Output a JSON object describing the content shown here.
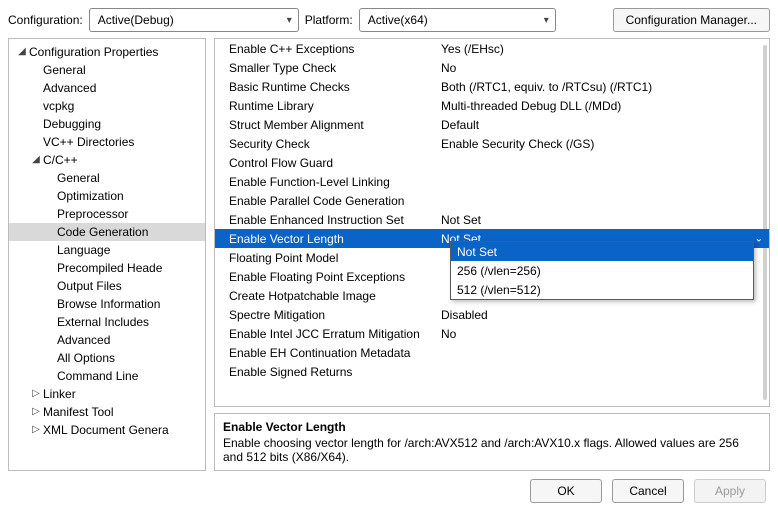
{
  "header": {
    "config_label": "Configuration:",
    "config_value": "Active(Debug)",
    "platform_label": "Platform:",
    "platform_value": "Active(x64)",
    "config_mgr": "Configuration Manager..."
  },
  "tree": {
    "root": "Configuration Properties",
    "items_l1": [
      "General",
      "Advanced",
      "vcpkg",
      "Debugging",
      "VC++ Directories"
    ],
    "cpp": "C/C++",
    "cpp_items": [
      "General",
      "Optimization",
      "Preprocessor",
      "Code Generation",
      "Language",
      "Precompiled Heade",
      "Output Files",
      "Browse Information",
      "External Includes",
      "Advanced",
      "All Options",
      "Command Line"
    ],
    "after": [
      "Linker",
      "Manifest Tool",
      "XML Document Genera"
    ]
  },
  "grid": [
    {
      "k": "Enable C++ Exceptions",
      "v": "Yes (/EHsc)"
    },
    {
      "k": "Smaller Type Check",
      "v": "No"
    },
    {
      "k": "Basic Runtime Checks",
      "v": "Both (/RTC1, equiv. to /RTCsu) (/RTC1)"
    },
    {
      "k": "Runtime Library",
      "v": "Multi-threaded Debug DLL (/MDd)"
    },
    {
      "k": "Struct Member Alignment",
      "v": "Default"
    },
    {
      "k": "Security Check",
      "v": "Enable Security Check (/GS)"
    },
    {
      "k": "Control Flow Guard",
      "v": ""
    },
    {
      "k": "Enable Function-Level Linking",
      "v": ""
    },
    {
      "k": "Enable Parallel Code Generation",
      "v": ""
    },
    {
      "k": "Enable Enhanced Instruction Set",
      "v": "Not Set"
    },
    {
      "k": "Enable Vector Length",
      "v": "Not Set"
    },
    {
      "k": "Floating Point Model",
      "v": ""
    },
    {
      "k": "Enable Floating Point Exceptions",
      "v": ""
    },
    {
      "k": "Create Hotpatchable Image",
      "v": ""
    },
    {
      "k": "Spectre Mitigation",
      "v": "Disabled"
    },
    {
      "k": "Enable Intel JCC Erratum Mitigation",
      "v": "No"
    },
    {
      "k": "Enable EH Continuation Metadata",
      "v": ""
    },
    {
      "k": "Enable Signed Returns",
      "v": ""
    }
  ],
  "dropdown": {
    "options": [
      "Not Set",
      "256 (/vlen=256)",
      "512 (/vlen=512)"
    ]
  },
  "desc": {
    "title": "Enable Vector Length",
    "body": "Enable choosing vector length for /arch:AVX512 and /arch:AVX10.x flags. Allowed values are 256 and 512 bits (X86/X64)."
  },
  "buttons": {
    "ok": "OK",
    "cancel": "Cancel",
    "apply": "Apply"
  }
}
